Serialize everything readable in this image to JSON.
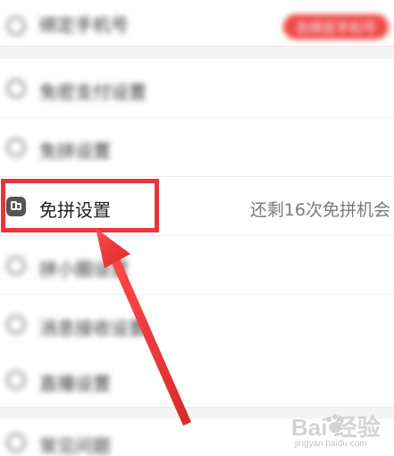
{
  "settings": {
    "rows": [
      {
        "label": "绑定手机号",
        "blurred": true,
        "pill": "去绑定手机号"
      },
      {
        "label": "免密支付设置",
        "blurred": true
      },
      {
        "label": "免拼设置",
        "blurred": true
      },
      {
        "label": "免拼设置",
        "blurred": false,
        "right_text": "还剩16次免拼机会"
      },
      {
        "label": "拼小圈设置",
        "blurred": true
      },
      {
        "label": "消息接收设置",
        "blurred": true
      },
      {
        "label": "直播设置",
        "blurred": true
      },
      {
        "label": "常见问题",
        "blurred": true
      }
    ]
  },
  "annotation": {
    "highlight_color": "#e8343a",
    "arrow_color": "#e8343a"
  },
  "watermark": {
    "brand": "Bai 经验",
    "sub": "jingyan.baidu.com"
  },
  "icons": {
    "row_icon": "circle-icon",
    "focus_row_icon": "coupon-icon"
  }
}
